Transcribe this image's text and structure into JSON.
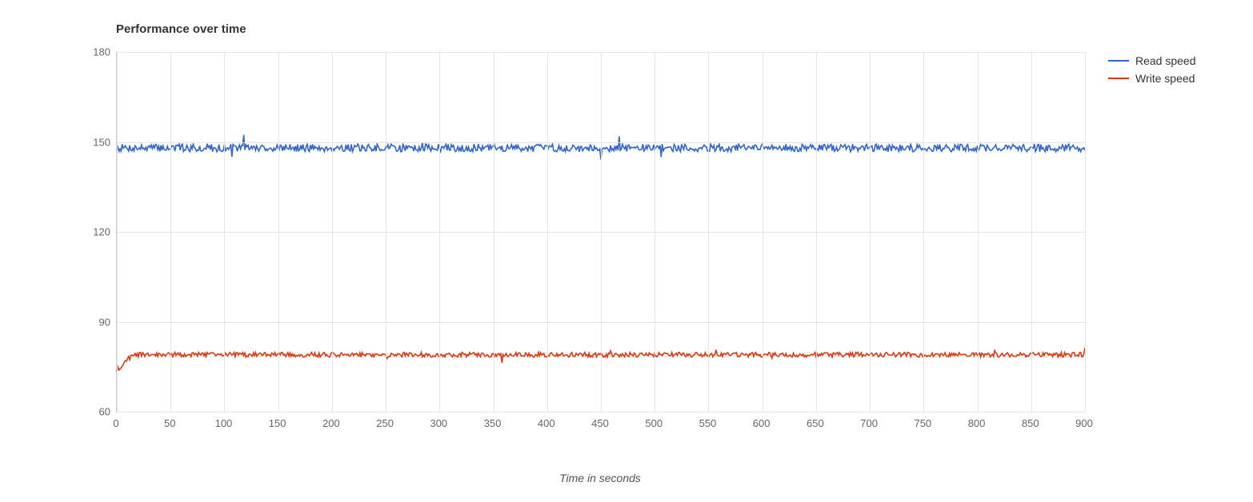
{
  "chart_data": {
    "type": "line",
    "title": "Performance over time",
    "xlabel": "Time in seconds",
    "ylabel": "",
    "xlim": [
      0,
      900
    ],
    "ylim": [
      60,
      180
    ],
    "x_ticks": [
      0,
      50,
      100,
      150,
      200,
      250,
      300,
      350,
      400,
      450,
      500,
      550,
      600,
      650,
      700,
      750,
      800,
      850,
      900
    ],
    "y_ticks": [
      60,
      90,
      120,
      150,
      180
    ],
    "series": [
      {
        "name": "Read speed",
        "color": "#3366cc",
        "mean": 148,
        "noise": 1.3,
        "start": 148
      },
      {
        "name": "Write speed",
        "color": "#dc3912",
        "mean": 79,
        "noise": 0.8,
        "start": 74
      }
    ],
    "legend_position": "right",
    "grid": true
  }
}
